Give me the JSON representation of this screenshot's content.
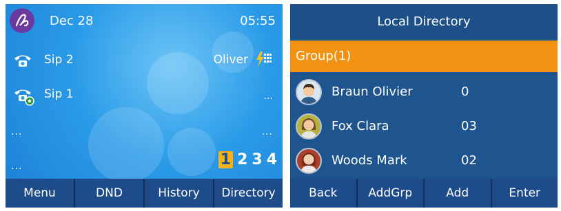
{
  "left_screen": {
    "date": "Dec 28",
    "time": "05:55",
    "lines": [
      {
        "label": "Sip 2",
        "right": "Oliver"
      },
      {
        "label": "Sip 1",
        "right": "..."
      }
    ],
    "dots_left_1": "...",
    "dots_right_1": "...",
    "dots_left_2": "...",
    "pages": [
      "1",
      "2",
      "3",
      "4"
    ],
    "active_page": "1",
    "softkeys": [
      "Menu",
      "DND",
      "History",
      "Directory"
    ]
  },
  "right_screen": {
    "title": "Local Directory",
    "group": "Group(1)",
    "contacts": [
      {
        "name": "Braun Olivier",
        "number": "0"
      },
      {
        "name": "Fox Clara",
        "number": "03"
      },
      {
        "name": "Woods Mark",
        "number": "02"
      }
    ],
    "softkeys": [
      "Back",
      "AddGrp",
      "Add",
      "Enter"
    ]
  },
  "colors": {
    "screen_blue": "#2a9be8",
    "softbar": "#1e4b8a",
    "group_highlight": "#f39212",
    "active_page": "#f3b21b",
    "logo_purple": "#6a3aa0"
  },
  "icons": [
    "logo-icon",
    "phone-icon",
    "phone-registered-icon",
    "lightning-keypad-icon",
    "avatar-icon"
  ]
}
